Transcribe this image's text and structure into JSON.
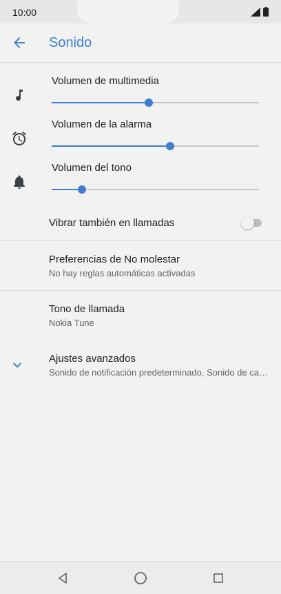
{
  "status_bar": {
    "time": "10:00"
  },
  "app_bar": {
    "title": "Sonido"
  },
  "volumes": [
    {
      "label": "Volumen de multimedia",
      "icon": "music-note-icon",
      "level": 0.47
    },
    {
      "label": "Volumen de la alarma",
      "icon": "alarm-clock-icon",
      "level": 0.57
    },
    {
      "label": "Volumen del tono",
      "icon": "bell-icon",
      "level": 0.145
    }
  ],
  "vibrate": {
    "label": "Vibrar también en llamadas",
    "enabled": false
  },
  "dnd": {
    "title": "Preferencias de No molestar",
    "subtitle": "No hay reglas automáticas activadas"
  },
  "ringtone": {
    "title": "Tono de llamada",
    "subtitle": "Nokia Tune"
  },
  "advanced": {
    "title": "Ajustes avanzados",
    "subtitle": "Sonido de notificación predeterminado, Sonido de carga, Otros sonidos y vibraciones"
  },
  "colors": {
    "accent": "#3f7fcf",
    "background": "#f2f2f2",
    "divider": "#d7d7d7"
  }
}
